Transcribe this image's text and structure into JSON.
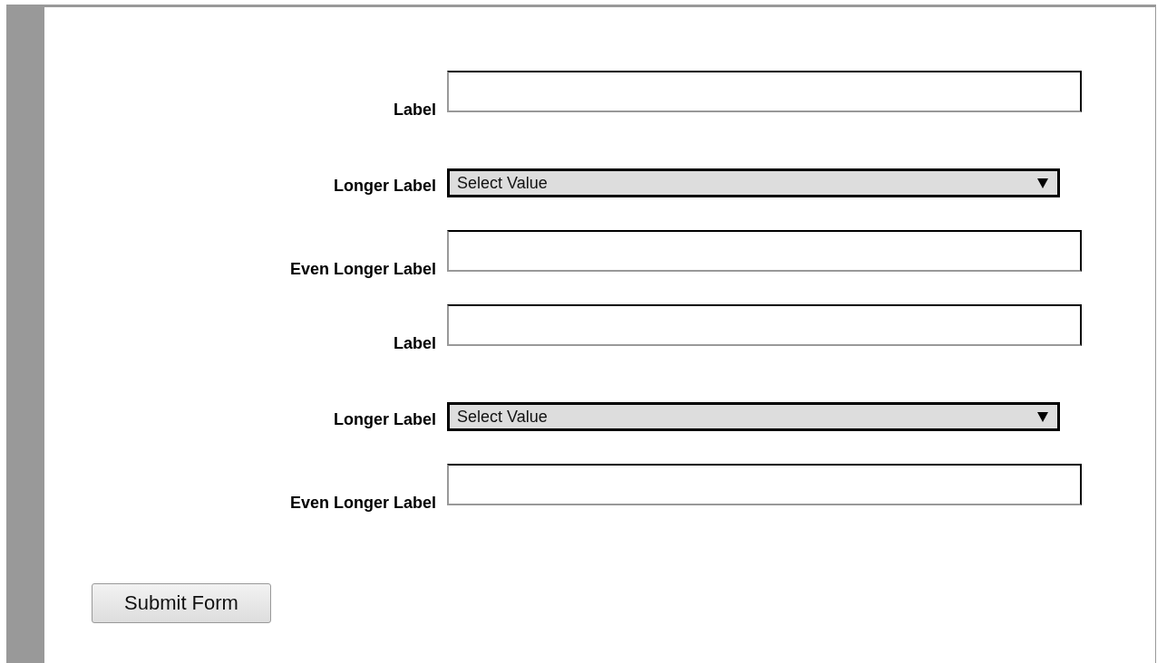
{
  "form": {
    "fields": [
      {
        "kind": "text",
        "label": "Label"
      },
      {
        "kind": "select",
        "label": "Longer Label",
        "value": "Select Value"
      },
      {
        "kind": "text",
        "label": "Even Longer Label"
      },
      {
        "kind": "text",
        "label": "Label"
      },
      {
        "kind": "select",
        "label": "Longer Label",
        "value": "Select Value"
      },
      {
        "kind": "text",
        "label": "Even Longer Label"
      }
    ],
    "submit": "Submit Form"
  }
}
